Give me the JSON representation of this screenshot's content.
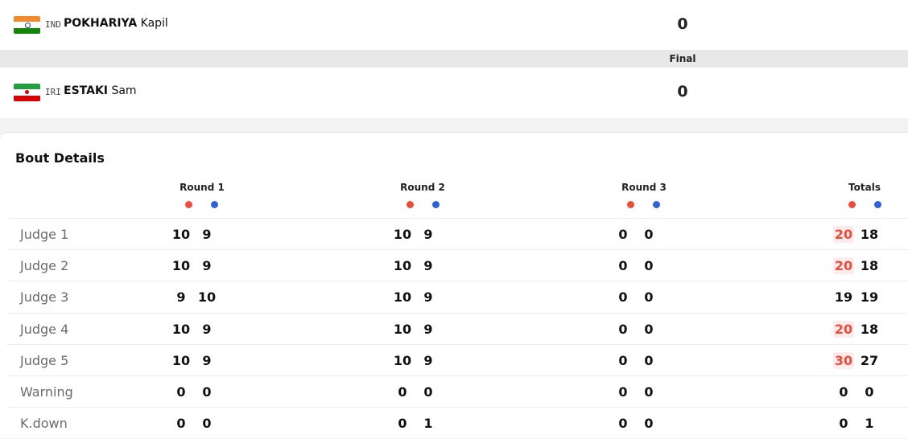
{
  "bout": {
    "status": "Final",
    "athletes": [
      {
        "country": "IND",
        "last_name": "POKHARIYA",
        "first_name": "Kapil",
        "score": "0",
        "flag_colors": [
          "#f08a2c",
          "#ffffff",
          "#138808"
        ],
        "flag_icon": "india-flag-icon"
      },
      {
        "country": "IRI",
        "last_name": "ESTAKI",
        "first_name": "Sam",
        "score": "0",
        "flag_colors": [
          "#239f40",
          "#ffffff",
          "#da0000"
        ],
        "flag_icon": "iran-flag-icon"
      }
    ]
  },
  "details": {
    "title": "Bout Details",
    "columns": [
      "Round 1",
      "Round 2",
      "Round 3",
      "Totals"
    ],
    "corner_colors": {
      "red": "#ef4b3a",
      "blue": "#2d63d8"
    },
    "rows": [
      {
        "label": "Judge 1",
        "values": [
          "10",
          "9",
          "10",
          "9",
          "0",
          "0",
          "20",
          "18"
        ],
        "red_total_highlight": true
      },
      {
        "label": "Judge 2",
        "values": [
          "10",
          "9",
          "10",
          "9",
          "0",
          "0",
          "20",
          "18"
        ],
        "red_total_highlight": true
      },
      {
        "label": "Judge 3",
        "values": [
          "9",
          "10",
          "10",
          "9",
          "0",
          "0",
          "19",
          "19"
        ],
        "red_total_highlight": false
      },
      {
        "label": "Judge 4",
        "values": [
          "10",
          "9",
          "10",
          "9",
          "0",
          "0",
          "20",
          "18"
        ],
        "red_total_highlight": true
      },
      {
        "label": "Judge 5",
        "values": [
          "10",
          "9",
          "10",
          "9",
          "0",
          "0",
          "30",
          "27"
        ],
        "red_total_highlight": true
      },
      {
        "label": "Warning",
        "values": [
          "0",
          "0",
          "0",
          "0",
          "0",
          "0",
          "0",
          "0"
        ],
        "red_total_highlight": false
      },
      {
        "label": "K.down",
        "values": [
          "0",
          "0",
          "0",
          "1",
          "0",
          "0",
          "0",
          "1"
        ],
        "red_total_highlight": false
      }
    ]
  }
}
